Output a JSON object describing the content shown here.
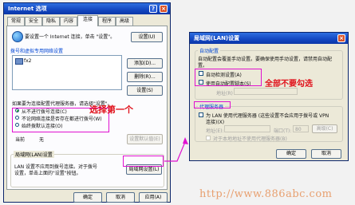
{
  "left_dialog": {
    "title": "Internet 选项",
    "tabs": [
      "常规",
      "安全",
      "隐私",
      "内容",
      "连接",
      "程序",
      "高级"
    ],
    "setup_text": "要设置一个 Internet 连接，单击 \"设置\"。",
    "setup_button": "设置(U)",
    "dialup_group": "拨号和虚拟专用网络设置",
    "dialup_item": "fx2",
    "add_button": "添加(D)...",
    "delete_button": "删除(R)...",
    "settings_button": "设置(S)",
    "proxy_note": "如果要为连接配置代理服务器，请选择\"设置\"。",
    "radio_options": [
      "从不进行拨号连接(C)",
      "不论网络连接是否存在都进行拨号(W)",
      "始终拨默认连接(O)"
    ],
    "selected_radio": 0,
    "current_label": "当前",
    "current_value": "无",
    "set_default_button": "设置默认值(E)",
    "lan_group": "局域网(LAN)设置",
    "lan_text": [
      "LAN 设置不应用到拨号连接。对于拨号",
      "设置，单击上面的\"设置\"按钮。"
    ],
    "lan_button": "局域网设置(L)",
    "ok_button": "确定",
    "cancel_button": "取消",
    "apply_button": "应用(A)"
  },
  "right_dialog": {
    "title": "局域网(LAN)设置",
    "auto_group": "自动配置",
    "auto_text": [
      "自动配置会覆盖手动设置。要确保使用手动设置，请禁用自动配",
      "置。"
    ],
    "auto_detect": "自动检测设置(A)",
    "auto_script": "使用自动配置脚本(S)",
    "address_label": "地址(R)",
    "proxy_group": "代理服务器",
    "proxy_use": [
      "为 LAN 使用代理服务器 (这些设置不会应用于拨号或 VPN",
      "连接)(X)"
    ],
    "proxy_address_label": "地址(E):",
    "port_label": "端口(T):",
    "port_value": "80",
    "advanced_button": "高级(C)",
    "bypass": "对于本地地址不使用代理服务器(B)",
    "ok_button": "确定",
    "cancel_button": "取消"
  },
  "annotations": {
    "select_first": "选择第一个",
    "uncheck_all": "全部不要勾选"
  },
  "watermark": "http://www.886abc.com",
  "colors": {
    "annotation_red": "#e0101a",
    "highlight_magenta": "#e010d0",
    "watermark": "#e8a070"
  }
}
